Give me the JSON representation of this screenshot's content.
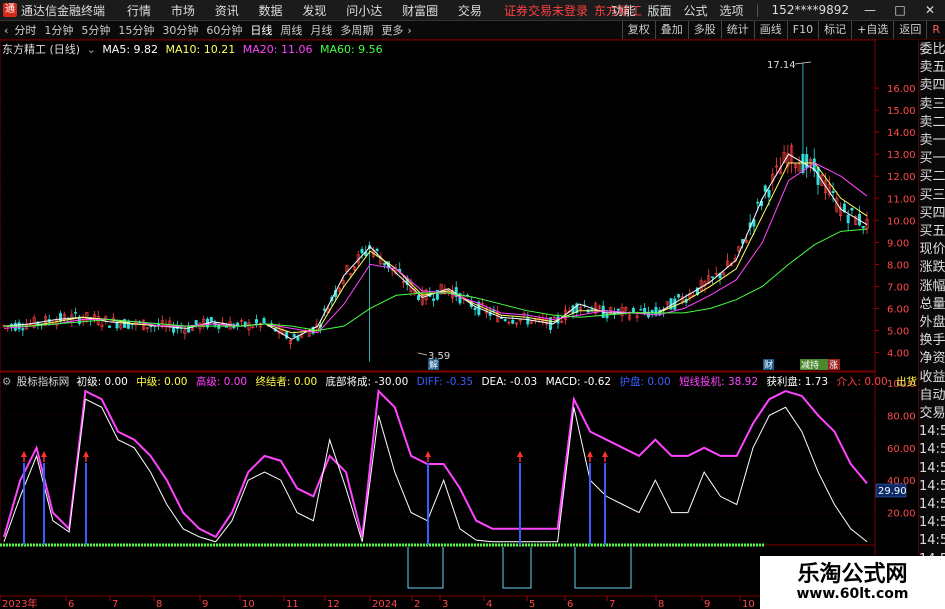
{
  "app": {
    "name": "通达信金融终端",
    "menu": [
      "行情",
      "市场",
      "资讯",
      "数据",
      "发现",
      "问小达",
      "财富圈",
      "交易"
    ],
    "warning": "证券交易未登录",
    "stock_link": "东方精工",
    "right_menu": [
      "功能",
      "版面",
      "公式",
      "选项"
    ],
    "account": "152****9892"
  },
  "toolbar": {
    "periods": [
      "分时",
      "1分钟",
      "5分钟",
      "15分钟",
      "30分钟",
      "60分钟",
      "日线",
      "周线",
      "月线",
      "多周期",
      "更多"
    ],
    "active_period": "日线",
    "right_buttons": [
      "复权",
      "叠加",
      "多股",
      "统计",
      "画线",
      "F10",
      "标记",
      "+自选",
      "返回"
    ],
    "r_badge": "R"
  },
  "main_chart": {
    "title": "东方精工 (日线)",
    "ma": [
      {
        "label": "MA5: 9.82",
        "color": "#ffffff"
      },
      {
        "label": "MA10: 10.21",
        "color": "#ffff66"
      },
      {
        "label": "MA20: 11.06",
        "color": "#ff44ff"
      },
      {
        "label": "MA60: 9.56",
        "color": "#44ff44"
      }
    ],
    "high_label": "17.14",
    "low_label": "3.59",
    "marks": [
      "解",
      "财",
      "减持",
      "涨"
    ]
  },
  "indicator": {
    "name": "股标指标网",
    "items": [
      {
        "label": "初级: 0.00",
        "color": "#ffffff"
      },
      {
        "label": "中级: 0.00",
        "color": "#ffff44"
      },
      {
        "label": "高级: 0.00",
        "color": "#ff44ff"
      },
      {
        "label": "终结者: 0.00",
        "color": "#ffff44"
      },
      {
        "label": "底部将成: -30.00",
        "color": "#ffffff"
      },
      {
        "label": "DIFF: -0.35",
        "color": "#3a5cff"
      },
      {
        "label": "DEA: -0.03",
        "color": "#ffffff"
      },
      {
        "label": "MACD: -0.62",
        "color": "#ffffff"
      },
      {
        "label": "护盘: 0.00",
        "color": "#3a5cff"
      },
      {
        "label": "短线投机: 38.92",
        "color": "#ff44ff"
      },
      {
        "label": "获利盘: 1.73",
        "color": "#ffffff"
      },
      {
        "label": "介入: 0.00",
        "color": "#ff4040"
      },
      {
        "label": "出货: 0.00",
        "color": "#ffff44"
      }
    ],
    "last_value": "29.90"
  },
  "sidebar": [
    "委比",
    "卖五",
    "卖四",
    "卖三",
    "卖二",
    "卖一",
    "买一",
    "买二",
    "买三",
    "买四",
    "买五",
    "现价",
    "涨跌",
    "涨幅",
    "总量",
    "外盘",
    "换手",
    "净资",
    "收益",
    "自动",
    "交易",
    "14:56",
    "14:56",
    "14:56",
    "14:56",
    "14:56",
    "14:56",
    "14:56",
    "14:56"
  ],
  "chart_data": [
    {
      "type": "line",
      "title": "东方精工 (日线)",
      "y_ticks": [
        4.0,
        5.0,
        6.0,
        7.0,
        8.0,
        9.0,
        10.0,
        11.0,
        12.0,
        13.0,
        14.0,
        15.0,
        16.0
      ],
      "ylim": [
        3.3,
        17.5
      ],
      "x_ticks": [
        "2023年",
        "6",
        "7",
        "8",
        "9",
        "10",
        "11",
        "12",
        "2024",
        "2",
        "3",
        "4",
        "5",
        "6",
        "7",
        "8",
        "9",
        "10",
        "11"
      ],
      "series": [
        {
          "name": "MA5",
          "color": "#ffffff",
          "values": [
            5.2,
            5.3,
            5.5,
            5.6,
            5.4,
            5.3,
            5.2,
            5.1,
            5.4,
            5.2,
            5.3,
            4.6,
            5.2,
            7.5,
            8.8,
            7.6,
            6.5,
            6.9,
            6.1,
            5.6,
            5.5,
            5.3,
            6.2,
            5.8,
            5.8,
            5.8,
            6.5,
            7.2,
            8.2,
            11.0,
            13.0,
            12.3,
            10.5,
            9.8
          ]
        },
        {
          "name": "MA10",
          "color": "#ffff66",
          "values": [
            5.2,
            5.2,
            5.4,
            5.6,
            5.5,
            5.3,
            5.2,
            5.2,
            5.3,
            5.2,
            5.3,
            4.9,
            5.0,
            7.0,
            8.6,
            7.8,
            6.6,
            6.8,
            6.2,
            5.7,
            5.6,
            5.4,
            5.9,
            5.9,
            5.8,
            5.8,
            6.3,
            7.0,
            7.8,
            10.2,
            12.6,
            12.6,
            11.0,
            10.2
          ]
        },
        {
          "name": "MA20",
          "color": "#ff44ff",
          "values": [
            5.1,
            5.2,
            5.3,
            5.5,
            5.5,
            5.4,
            5.2,
            5.2,
            5.3,
            5.2,
            5.3,
            5.1,
            4.9,
            6.2,
            8.0,
            7.8,
            6.8,
            6.7,
            6.3,
            5.8,
            5.7,
            5.5,
            5.7,
            5.9,
            5.8,
            5.7,
            6.0,
            6.6,
            7.3,
            9.0,
            11.8,
            12.6,
            12.0,
            11.1
          ]
        },
        {
          "name": "MA60",
          "color": "#44ff44",
          "values": [
            5.2,
            5.2,
            5.3,
            5.4,
            5.5,
            5.4,
            5.3,
            5.2,
            5.2,
            5.2,
            5.3,
            5.2,
            5.0,
            5.2,
            6.0,
            6.6,
            6.7,
            6.7,
            6.5,
            6.2,
            5.9,
            5.7,
            5.6,
            5.7,
            5.8,
            5.8,
            5.8,
            6.0,
            6.4,
            7.0,
            8.0,
            8.9,
            9.5,
            9.6
          ]
        }
      ]
    },
    {
      "type": "line",
      "title": "股标指标网",
      "y_ticks": [
        20.0,
        40.0,
        60.0,
        80.0,
        100.0
      ],
      "ylim": [
        0,
        100
      ],
      "series": [
        {
          "name": "短线投机",
          "color": "#ff44ff",
          "values": [
            5,
            40,
            60,
            20,
            10,
            95,
            90,
            70,
            65,
            55,
            40,
            20,
            10,
            5,
            20,
            45,
            55,
            52,
            35,
            30,
            55,
            45,
            5,
            95,
            85,
            55,
            50,
            50,
            35,
            15,
            10,
            10,
            10,
            10,
            10,
            90,
            70,
            65,
            60,
            55,
            65,
            55,
            55,
            60,
            55,
            55,
            75,
            90,
            95,
            92,
            80,
            70,
            50,
            38
          ]
        },
        {
          "name": "获利盘",
          "color": "#ffffff",
          "values": [
            2,
            30,
            55,
            15,
            8,
            90,
            85,
            65,
            60,
            45,
            25,
            10,
            5,
            2,
            15,
            40,
            45,
            40,
            20,
            15,
            65,
            35,
            2,
            80,
            45,
            20,
            15,
            40,
            10,
            3,
            2,
            2,
            2,
            2,
            2,
            85,
            40,
            30,
            25,
            20,
            40,
            20,
            20,
            45,
            30,
            25,
            60,
            80,
            85,
            70,
            45,
            25,
            10,
            2
          ]
        }
      ]
    }
  ]
}
